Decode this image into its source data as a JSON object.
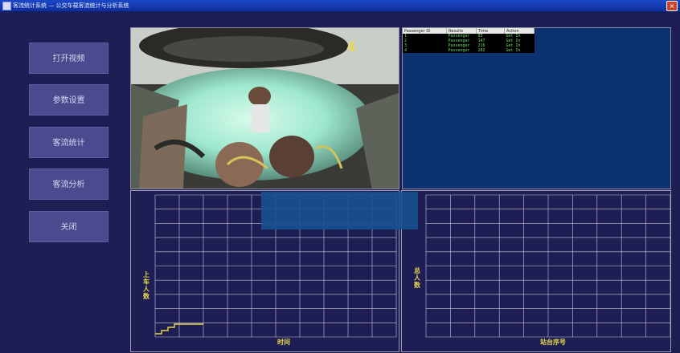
{
  "window": {
    "title": "客流统计系统 — 公交车载客流统计与分析系统",
    "close_label": "×"
  },
  "menu": [
    {
      "label": "打开视频"
    },
    {
      "label": "参数设置"
    },
    {
      "label": "客流统计"
    },
    {
      "label": "客流分析"
    },
    {
      "label": "关闭"
    }
  ],
  "video": {
    "camera_number": "4"
  },
  "log": {
    "columns": [
      "Passenger ID",
      "Results",
      "Time",
      "Action"
    ],
    "rows": [
      [
        "1",
        "Passenger",
        "93",
        "Get In"
      ],
      [
        "2",
        "Passenger",
        "147",
        "Get In"
      ],
      [
        "3",
        "Passenger",
        "216",
        "Get In"
      ],
      [
        "4",
        "Passenger",
        "282",
        "Get In"
      ]
    ]
  },
  "boarding_chart": {
    "ylabel": "上车人数",
    "xlabel": "时间"
  },
  "total_chart": {
    "ylabel": "总人数",
    "xlabel": "站台序号"
  },
  "colors": {
    "background": "#1e1e55",
    "grid": "#c8c8d8",
    "label": "#e8d84c",
    "step_line": "#e8d84c",
    "log_text": "#6fd86f",
    "log_bg": "#0d3270"
  },
  "chart_data": [
    {
      "type": "line",
      "title": "",
      "xlabel": "时间",
      "ylabel": "上车人数",
      "grid": true,
      "series": [
        {
          "values": [
            1,
            1,
            2,
            2,
            3,
            3,
            4,
            4
          ]
        }
      ],
      "x": [
        0,
        1,
        1,
        2,
        2,
        3,
        3,
        4
      ]
    },
    {
      "type": "line",
      "title": "",
      "xlabel": "站台序号",
      "ylabel": "总人数",
      "grid": true,
      "series": []
    }
  ]
}
